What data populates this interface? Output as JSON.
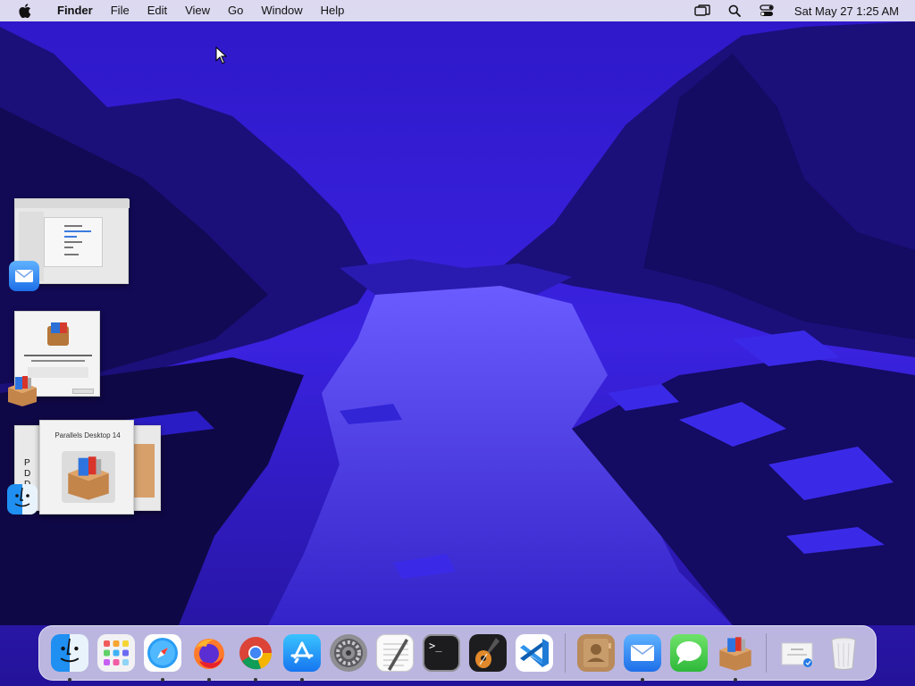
{
  "menubar": {
    "app_name": "Finder",
    "menus": [
      "File",
      "Edit",
      "View",
      "Go",
      "Window",
      "Help"
    ],
    "clock": "Sat May 27  1:25 AM",
    "status_icons": [
      "screen-mirroring-icon",
      "spotlight-search-icon",
      "control-center-icon"
    ]
  },
  "stage_manager": {
    "groups": [
      {
        "app": "Mail",
        "icon": "mail-icon"
      },
      {
        "app": "Parallels Desktop Installer",
        "icon": "parallels-box-icon"
      },
      {
        "app": "Finder",
        "icon": "finder-icon",
        "window_title": "Parallels Desktop 14"
      }
    ]
  },
  "dock": {
    "apps": [
      {
        "name": "Finder",
        "icon": "finder-icon",
        "running": true
      },
      {
        "name": "Launchpad",
        "icon": "launchpad-icon",
        "running": false
      },
      {
        "name": "Safari",
        "icon": "safari-icon",
        "running": true
      },
      {
        "name": "Firefox",
        "icon": "firefox-icon",
        "running": true
      },
      {
        "name": "Google Chrome",
        "icon": "chrome-icon",
        "running": true
      },
      {
        "name": "App Store",
        "icon": "app-store-icon",
        "running": true
      },
      {
        "name": "System Preferences",
        "icon": "system-preferences-icon",
        "running": false
      },
      {
        "name": "TextEdit",
        "icon": "textedit-icon",
        "running": false
      },
      {
        "name": "Terminal",
        "icon": "terminal-icon",
        "running": false
      },
      {
        "name": "GarageBand",
        "icon": "garageband-icon",
        "running": false
      },
      {
        "name": "Visual Studio Code",
        "icon": "vscode-icon",
        "running": false
      },
      {
        "name": "Contacts",
        "icon": "contacts-icon",
        "running": false
      },
      {
        "name": "Mail",
        "icon": "mail-icon",
        "running": true
      },
      {
        "name": "Messages",
        "icon": "messages-icon",
        "running": false
      },
      {
        "name": "Parallels Desktop",
        "icon": "parallels-box-icon",
        "running": true
      },
      {
        "name": "Downloads",
        "icon": "downloads-stack-icon",
        "running": false
      },
      {
        "name": "Trash",
        "icon": "trash-icon",
        "running": false
      }
    ],
    "terminal_prompt": ">_"
  },
  "colors": {
    "sky": "#3d1fd6",
    "deep": "#1a0f5c",
    "river": "#4a3ef0",
    "mountain": "#22158c"
  }
}
